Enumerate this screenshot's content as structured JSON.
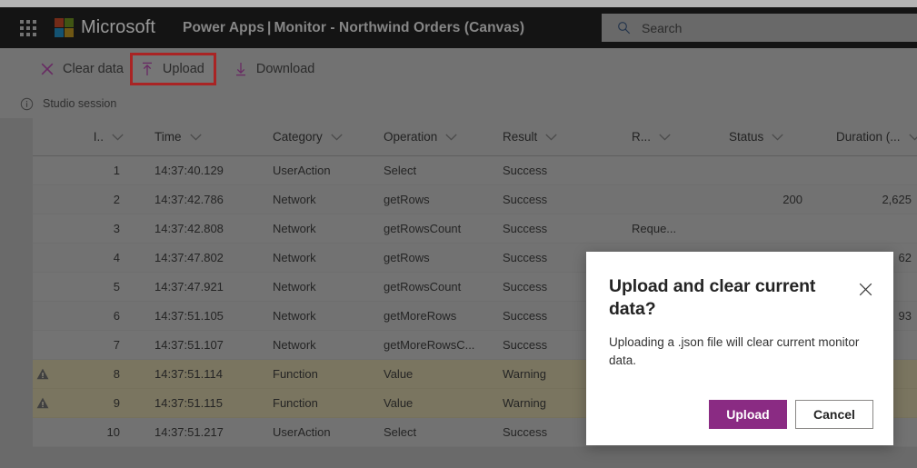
{
  "colors": {
    "brand_purple": "#8a2b83",
    "suitebar_bg": "#0a0a0a",
    "highlight_red": "#ee2222",
    "warning_row_bg": "#a79f7e",
    "chrome_gray": "#9a9a9a"
  },
  "suitebar": {
    "waffle_label": "App launcher",
    "brand": "Microsoft",
    "product": "Power Apps",
    "separator": "|",
    "page_title": "Monitor - Northwind Orders (Canvas)"
  },
  "search": {
    "placeholder": "Search",
    "value": "",
    "icon": "search-icon"
  },
  "commandbar": {
    "items": [
      {
        "label": "Clear data",
        "icon": "close-x-icon",
        "highlighted": false
      },
      {
        "label": "Upload",
        "icon": "upload-arrow-icon",
        "highlighted": true
      },
      {
        "label": "Download",
        "icon": "download-arrow-icon",
        "highlighted": false
      }
    ]
  },
  "session": {
    "icon": "info-circle-icon",
    "label": "Studio session"
  },
  "table": {
    "columns": [
      {
        "key": "flag",
        "label": "",
        "sortable": false
      },
      {
        "key": "id",
        "label": "I..",
        "sortable": true
      },
      {
        "key": "time",
        "label": "Time",
        "sortable": true
      },
      {
        "key": "category",
        "label": "Category",
        "sortable": true
      },
      {
        "key": "operation",
        "label": "Operation",
        "sortable": true
      },
      {
        "key": "result",
        "label": "Result",
        "sortable": true
      },
      {
        "key": "r",
        "label": "R...",
        "sortable": true
      },
      {
        "key": "status",
        "label": "Status",
        "sortable": true
      },
      {
        "key": "duration",
        "label": "Duration (...",
        "sortable": true
      }
    ],
    "rows": [
      {
        "flag": "",
        "id": "1",
        "time": "14:37:40.129",
        "category": "UserAction",
        "operation": "Select",
        "result": "Success",
        "r": "",
        "status": "",
        "duration": "",
        "severity": "normal"
      },
      {
        "flag": "",
        "id": "2",
        "time": "14:37:42.786",
        "category": "Network",
        "operation": "getRows",
        "result": "Success",
        "r": "",
        "status": "200",
        "duration": "2,625",
        "severity": "normal"
      },
      {
        "flag": "",
        "id": "3",
        "time": "14:37:42.808",
        "category": "Network",
        "operation": "getRowsCount",
        "result": "Success",
        "r": "Reque...",
        "status": "",
        "duration": "",
        "severity": "normal"
      },
      {
        "flag": "",
        "id": "4",
        "time": "14:37:47.802",
        "category": "Network",
        "operation": "getRows",
        "result": "Success",
        "r": "",
        "status": "",
        "duration": "62",
        "severity": "normal"
      },
      {
        "flag": "",
        "id": "5",
        "time": "14:37:47.921",
        "category": "Network",
        "operation": "getRowsCount",
        "result": "Success",
        "r": "",
        "status": "",
        "duration": "",
        "severity": "normal"
      },
      {
        "flag": "",
        "id": "6",
        "time": "14:37:51.105",
        "category": "Network",
        "operation": "getMoreRows",
        "result": "Success",
        "r": "",
        "status": "",
        "duration": "93",
        "severity": "normal"
      },
      {
        "flag": "",
        "id": "7",
        "time": "14:37:51.107",
        "category": "Network",
        "operation": "getMoreRowsC...",
        "result": "Success",
        "r": "",
        "status": "",
        "duration": "",
        "severity": "normal"
      },
      {
        "flag": "warning",
        "id": "8",
        "time": "14:37:51.114",
        "category": "Function",
        "operation": "Value",
        "result": "Warning",
        "r": "",
        "status": "",
        "duration": "",
        "severity": "warning"
      },
      {
        "flag": "warning",
        "id": "9",
        "time": "14:37:51.115",
        "category": "Function",
        "operation": "Value",
        "result": "Warning",
        "r": "",
        "status": "",
        "duration": "",
        "severity": "warning"
      },
      {
        "flag": "",
        "id": "10",
        "time": "14:37:51.217",
        "category": "UserAction",
        "operation": "Select",
        "result": "Success",
        "r": "",
        "status": "",
        "duration": "",
        "severity": "normal"
      }
    ]
  },
  "dialog": {
    "title": "Upload and clear current data?",
    "body": "Uploading a .json file will clear current monitor data.",
    "close_icon": "close-icon",
    "primary_button": "Upload",
    "secondary_button": "Cancel"
  }
}
